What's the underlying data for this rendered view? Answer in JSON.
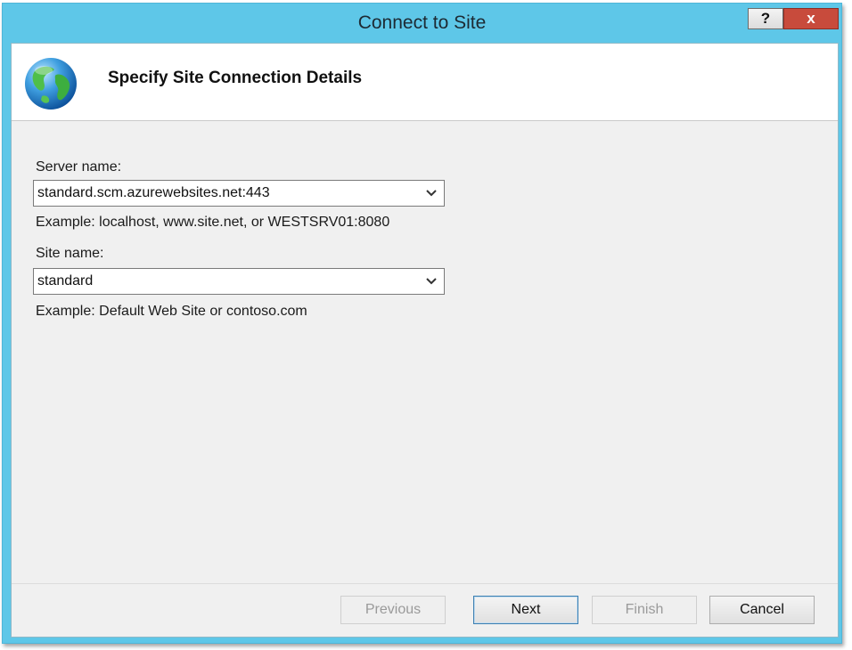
{
  "window": {
    "title": "Connect to Site",
    "help_label": "?",
    "close_label": "x"
  },
  "header": {
    "title": "Specify Site Connection Details",
    "icon": "globe-icon"
  },
  "form": {
    "server_name": {
      "label": "Server name:",
      "value": "standard.scm.azurewebsites.net:443",
      "example": "Example: localhost, www.site.net, or WESTSRV01:8080"
    },
    "site_name": {
      "label": "Site name:",
      "value": "standard",
      "example": "Example: Default Web Site or contoso.com"
    }
  },
  "buttons": {
    "previous": "Previous",
    "next": "Next",
    "finish": "Finish",
    "cancel": "Cancel"
  },
  "colors": {
    "titlebar": "#5ec7e8",
    "close": "#c84b3c",
    "panel": "#f0f0f0"
  }
}
